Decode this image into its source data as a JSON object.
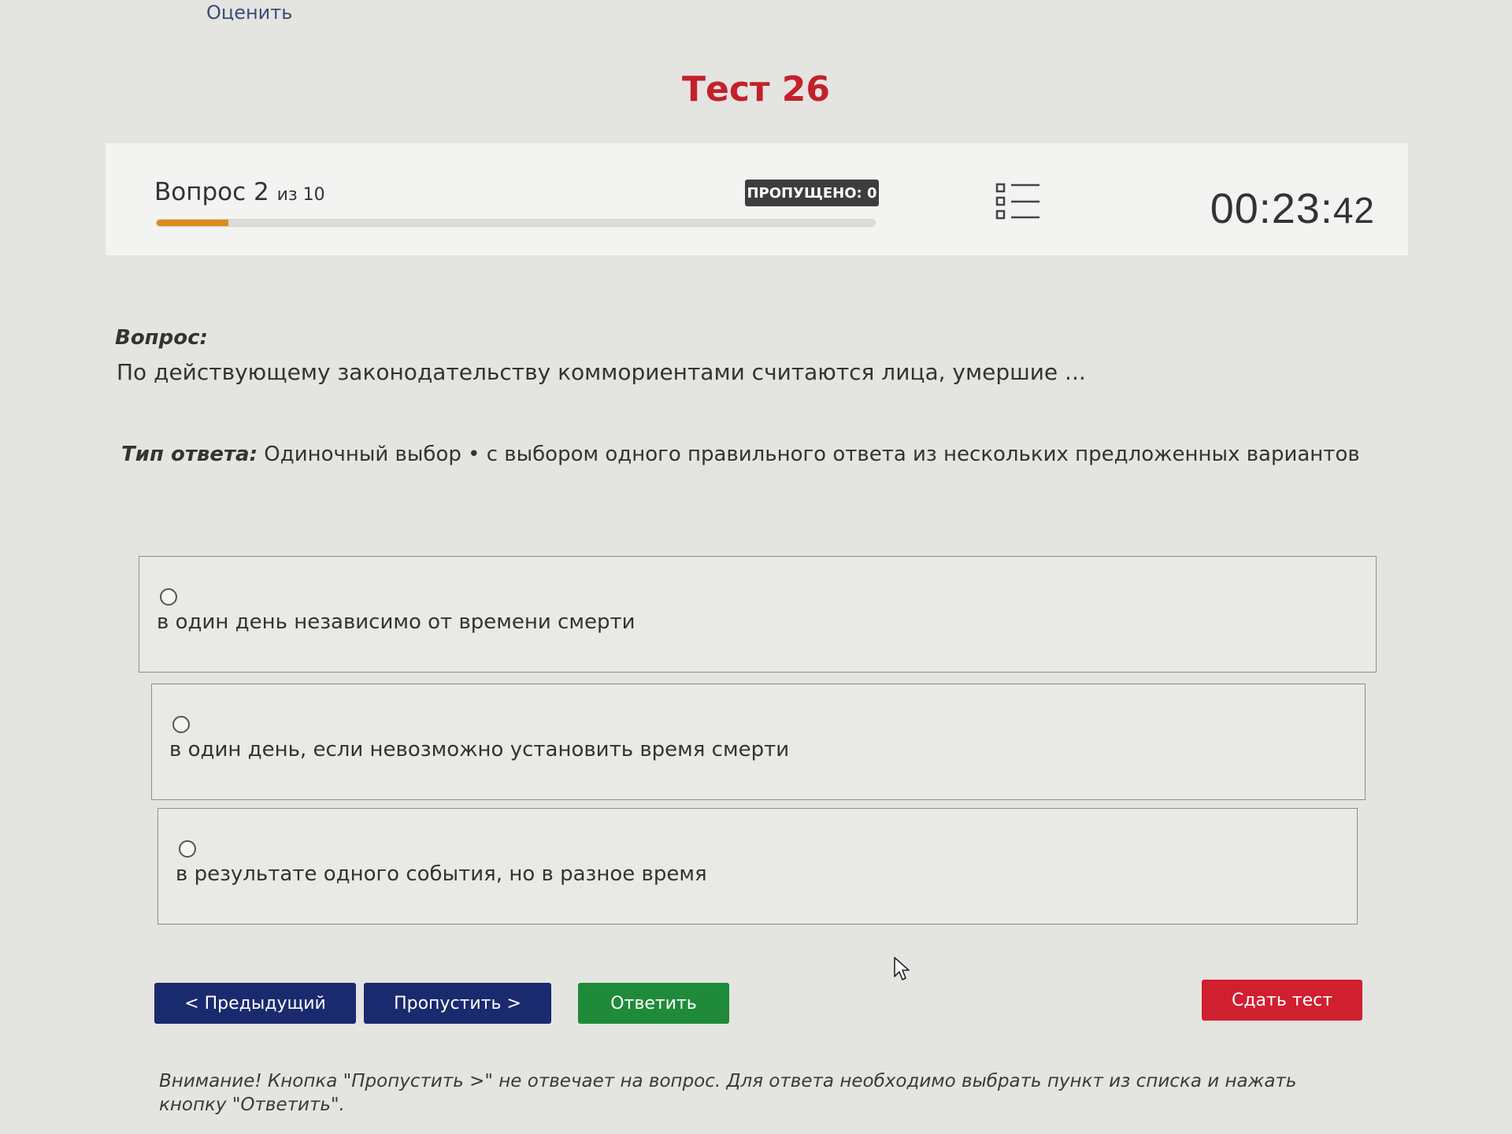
{
  "top_link": "Оценить",
  "test_title": "Тест 26",
  "header": {
    "question_prefix": "Вопрос 2",
    "question_of": "из 10",
    "progress": 0.1,
    "skipped_badge": "ПРОПУЩЕНО: 0",
    "list_icon": "question-list-icon",
    "timer_main": "00:23:",
    "timer_seconds": "42"
  },
  "question": {
    "label": "Вопрос:",
    "text": "По действующему законодательству коммориентами считаются лица, умершие ..."
  },
  "answer_type": {
    "label": "Тип ответа:",
    "value": "Одиночный выбор • с выбором одного правильного ответа из нескольких предложенных вариантов"
  },
  "options": [
    {
      "text": "в один день независимо от времени смерти"
    },
    {
      "text": "в один день, если невозможно установить время смерти"
    },
    {
      "text": "в результате одного события, но в разное время"
    }
  ],
  "buttons": {
    "prev": "< Предыдущий",
    "skip": "Пропустить >",
    "answer": "Ответить",
    "submit": "Сдать тест"
  },
  "notice": "Внимание! Кнопка \"Пропустить >\" не отвечает на вопрос. Для ответа необходимо выбрать пункт из списка и нажать кнопку \"Ответить\".",
  "colors": {
    "title": "#c4202c",
    "progress_fill": "#d98a1c",
    "nav_button": "#1a2a6e",
    "answer_button": "#1f8a3a",
    "submit_button": "#d01f2f",
    "badge": "#3d3d3f"
  }
}
